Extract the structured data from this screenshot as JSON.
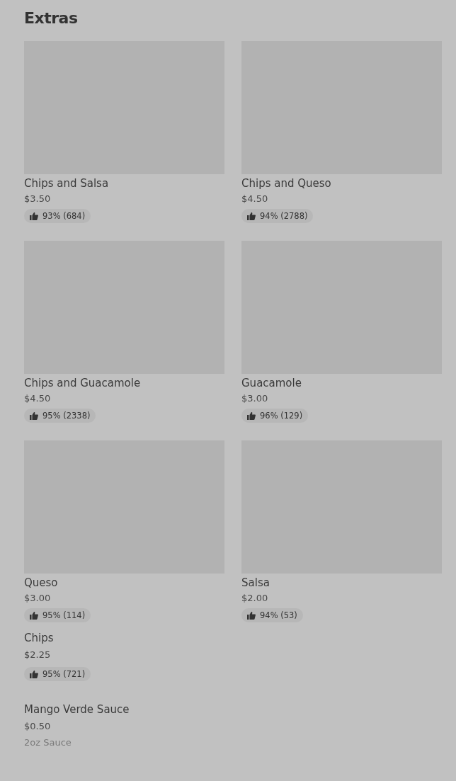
{
  "section": {
    "title": "Extras"
  },
  "items": [
    {
      "kind": "card",
      "name": "Chips and Salsa",
      "price": "$3.50",
      "rating": "93% (684)"
    },
    {
      "kind": "card",
      "name": "Chips and Queso",
      "price": "$4.50",
      "rating": "94% (2788)"
    },
    {
      "kind": "card",
      "name": "Chips and Guacamole",
      "price": "$4.50",
      "rating": "95% (2338)"
    },
    {
      "kind": "card",
      "name": "Guacamole",
      "price": "$3.00",
      "rating": "96% (129)"
    },
    {
      "kind": "card",
      "name": "Queso",
      "price": "$3.00",
      "rating": "95% (114)"
    },
    {
      "kind": "card",
      "name": "Salsa",
      "price": "$2.00",
      "rating": "94% (53)"
    },
    {
      "kind": "row",
      "name": "Chips",
      "price": "$2.25",
      "rating": "95% (721)"
    },
    {
      "kind": "row",
      "name": "Mango Verde Sauce",
      "price": "$0.50",
      "description": "2oz Sauce"
    }
  ]
}
